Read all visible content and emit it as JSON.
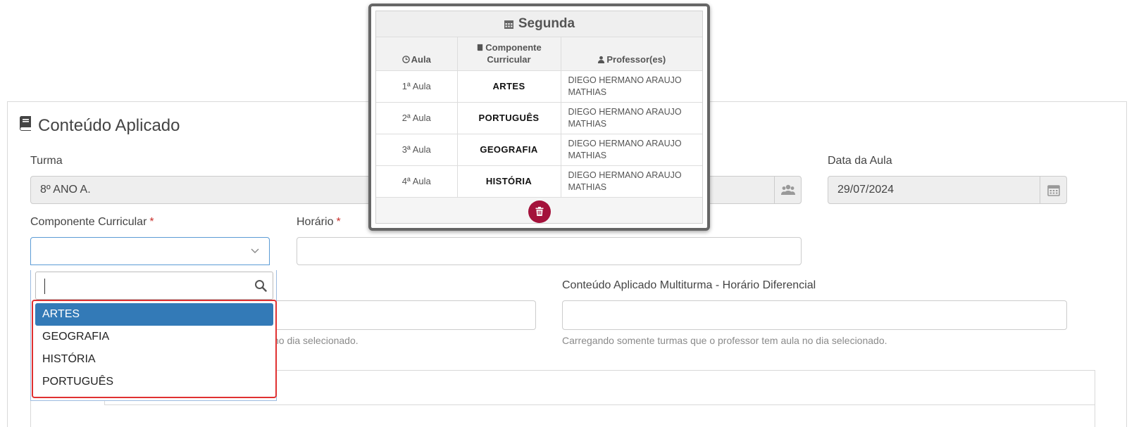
{
  "panel": {
    "title": "Conteúdo Aplicado"
  },
  "form": {
    "turma_label": "Turma",
    "turma_value": "8º ANO A.",
    "data_label": "Data da Aula",
    "data_value": "29/07/2024",
    "componente_label": "Componente Curricular",
    "componente_required": "*",
    "horario_label": "Horário",
    "horario_required": "*",
    "multiturma_label": "Conteúdo Aplicado Multiturma - Horário Diferencial",
    "multiturma_help": "Carregando somente turmas que o professor tem aula no dia selecionado.",
    "left_help_fragment": "no dia selecionado."
  },
  "dropdown": {
    "search_value": "",
    "options": [
      "ARTES",
      "GEOGRAFIA",
      "HISTÓRIA",
      "PORTUGUÊS"
    ],
    "active_index": 0
  },
  "schedule": {
    "day": "Segunda",
    "headers": {
      "aula": "Aula",
      "componente_line1": "Componente",
      "componente_line2": "Curricular",
      "professor": "Professor(es)"
    },
    "rows": [
      {
        "aula": "1ª Aula",
        "componente": "ARTES",
        "prof_line1": "DIEGO HERMANO ARAUJO",
        "prof_line2": "MATHIAS"
      },
      {
        "aula": "2ª Aula",
        "componente": "PORTUGUÊS",
        "prof_line1": "DIEGO HERMANO ARAUJO",
        "prof_line2": "MATHIAS"
      },
      {
        "aula": "3ª Aula",
        "componente": "GEOGRAFIA",
        "prof_line1": "DIEGO HERMANO ARAUJO",
        "prof_line2": "MATHIAS"
      },
      {
        "aula": "4ª Aula",
        "componente": "HISTÓRIA",
        "prof_line1": "DIEGO HERMANO ARAUJO",
        "prof_line2": "MATHIAS"
      }
    ]
  },
  "icons": {
    "title_icon": "book-icon",
    "turma_addon": "users-icon",
    "data_addon": "calendar-icon",
    "search": "search-icon",
    "delete": "trash-icon",
    "accent": "#337ab7",
    "danger": "#a4123b",
    "highlight": "#e03131"
  }
}
